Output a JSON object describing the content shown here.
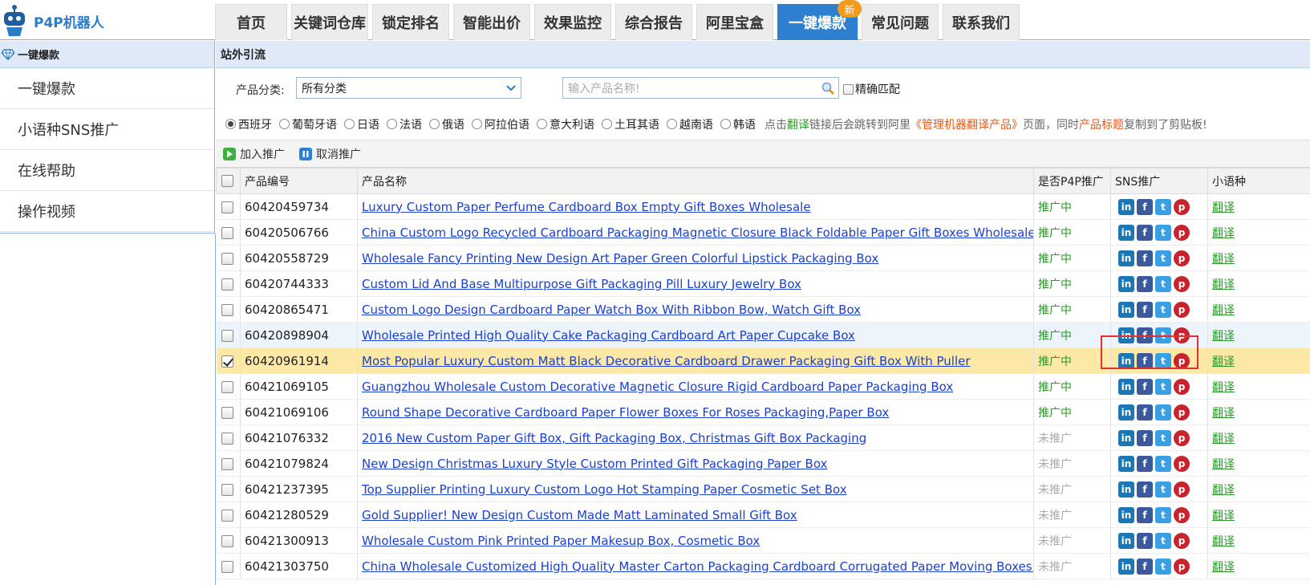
{
  "app": {
    "logo_text": "P4P机器人"
  },
  "nav": [
    {
      "label": "首页",
      "width": 90
    },
    {
      "label": "关键词仓库",
      "width": 96
    },
    {
      "label": "锁定排名",
      "width": 96
    },
    {
      "label": "智能出价",
      "width": 96
    },
    {
      "label": "效果监控",
      "width": 96
    },
    {
      "label": "综合报告",
      "width": 96
    },
    {
      "label": "阿里宝盒",
      "width": 96
    },
    {
      "label": "一键爆款",
      "width": 100,
      "active": true,
      "badge": "新"
    },
    {
      "label": "常见问题",
      "width": 96
    },
    {
      "label": "联系我们",
      "width": 96
    }
  ],
  "sidebar": {
    "title": "一键爆款",
    "items": [
      "一键爆款",
      "小语种SNS推广",
      "在线帮助",
      "操作视频"
    ]
  },
  "panel": {
    "title": "站外引流"
  },
  "filters": {
    "category_label": "产品分类:",
    "category_value": "所有分类",
    "search_placeholder": "输入产品名称!",
    "exact_label": "精确匹配"
  },
  "languages": {
    "selected": "西班牙",
    "items": [
      "西班牙",
      "葡萄牙语",
      "日语",
      "法语",
      "俄语",
      "阿拉伯语",
      "意大利语",
      "土耳其语",
      "越南语",
      "韩语"
    ]
  },
  "hint": {
    "p1": "点击",
    "g1": "翻译",
    "p2": "链接后会跳转到阿里",
    "r1": "《管理机器翻译产品》",
    "p3": "页面，同时",
    "r2": "产品标题",
    "p4": "复制到了剪贴板!"
  },
  "toolbar": {
    "add": "加入推广",
    "cancel": "取消推广"
  },
  "table": {
    "headers": {
      "id": "产品编号",
      "name": "产品名称",
      "p4p": "是否P4P推广",
      "sns": "SNS推广",
      "lang": "小语种"
    },
    "translate_label": "翻译",
    "rows": [
      {
        "id": "60420459734",
        "name": "Luxury Custom Paper Perfume Cardboard Box Empty Gift Boxes Wholesale",
        "status": "推广中",
        "on": true
      },
      {
        "id": "60420506766",
        "name": "China Custom Logo Recycled Cardboard Packaging Magnetic Closure Black Foldable Paper Gift Boxes Wholesale",
        "status": "推广中",
        "on": true
      },
      {
        "id": "60420558729",
        "name": "Wholesale Fancy Printing New Design Art Paper Green Colorful Lipstick Packaging Box",
        "status": "推广中",
        "on": true
      },
      {
        "id": "60420744333",
        "name": "Custom Lid And Base Multipurpose Gift Packaging Pill Luxury Jewelry Box",
        "status": "推广中",
        "on": true
      },
      {
        "id": "60420865471",
        "name": "Custom Logo Design Cardboard Paper Watch Box With Ribbon Bow, Watch Gift Box",
        "status": "推广中",
        "on": true
      },
      {
        "id": "60420898904",
        "name": "Wholesale Printed High Quality Cake Packaging Cardboard Art Paper Cupcake Box",
        "status": "推广中",
        "on": true,
        "hover": true
      },
      {
        "id": "60420961914",
        "name": "Most Popular Luxury Custom Matt Black Decorative Cardboard Drawer Packaging Gift Box With Puller",
        "status": "推广中",
        "on": true,
        "selected": true
      },
      {
        "id": "60421069105",
        "name": "Guangzhou Wholesale Custom Decorative Magnetic Closure Rigid Cardboard Paper Packaging Box",
        "status": "推广中",
        "on": true
      },
      {
        "id": "60421069106",
        "name": "Round Shape Decorative Cardboard Paper Flower Boxes For Roses Packaging,Paper Box",
        "status": "推广中",
        "on": true
      },
      {
        "id": "60421076332",
        "name": "2016 New Custom Paper Gift Box, Gift Packaging Box, Christmas Gift Box Packaging",
        "status": "未推广",
        "on": false
      },
      {
        "id": "60421079824",
        "name": "New Design Christmas Luxury Style Custom Printed Gift Packaging Paper Box",
        "status": "未推广",
        "on": false
      },
      {
        "id": "60421237395",
        "name": "Top Supplier Printing Luxury Custom Logo Hot Stamping Paper Cosmetic Set Box",
        "status": "未推广",
        "on": false
      },
      {
        "id": "60421280529",
        "name": "Gold Supplier! New Design Custom Made Matt Laminated Small Gift Box",
        "status": "未推广",
        "on": false
      },
      {
        "id": "60421300913",
        "name": "Wholesale Custom Pink Printed Paper Makesup Box, Cosmetic Box",
        "status": "未推广",
        "on": false
      },
      {
        "id": "60421303750",
        "name": "China Wholesale Customized High Quality Master Carton Packaging Cardboard Corrugated Paper Moving Boxes for Packing",
        "status": "未推广",
        "on": false
      }
    ]
  },
  "colors": {
    "accent": "#2d7fd0",
    "badge": "#f19a1b",
    "promoted": "#2a9a2a",
    "highlight": "#fde9a5",
    "callout": "#e03030"
  }
}
